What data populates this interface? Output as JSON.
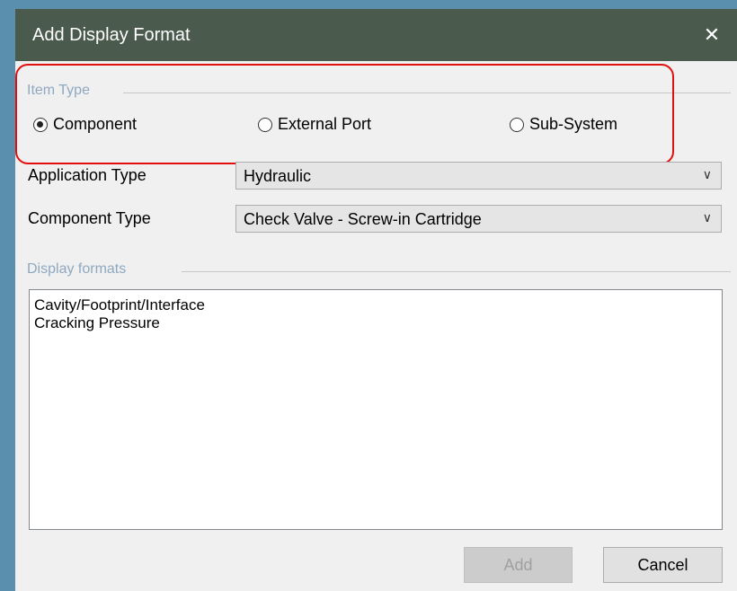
{
  "window": {
    "title": "Add Display Format",
    "close_glyph": "✕"
  },
  "item_type": {
    "group_label": "Item Type",
    "options": [
      {
        "label": "Component",
        "selected": true
      },
      {
        "label": "External Port",
        "selected": false
      },
      {
        "label": "Sub-System",
        "selected": false
      }
    ]
  },
  "application_type": {
    "label": "Application Type",
    "value": "Hydraulic"
  },
  "component_type": {
    "label": "Component Type",
    "value": "Check Valve - Screw-in Cartridge"
  },
  "display_formats": {
    "group_label": "Display formats",
    "items": [
      "Cavity/Footprint/Interface",
      "Cracking Pressure"
    ]
  },
  "buttons": {
    "add_label": "Add",
    "add_enabled": false,
    "cancel_label": "Cancel"
  },
  "icons": {
    "close": "close-icon",
    "dropdown": "chevron-down-icon"
  },
  "colors": {
    "titlebar": "#4a5a4d",
    "highlight": "#e01010",
    "group_label": "#8fa8c0",
    "background": "#5a8fad"
  }
}
